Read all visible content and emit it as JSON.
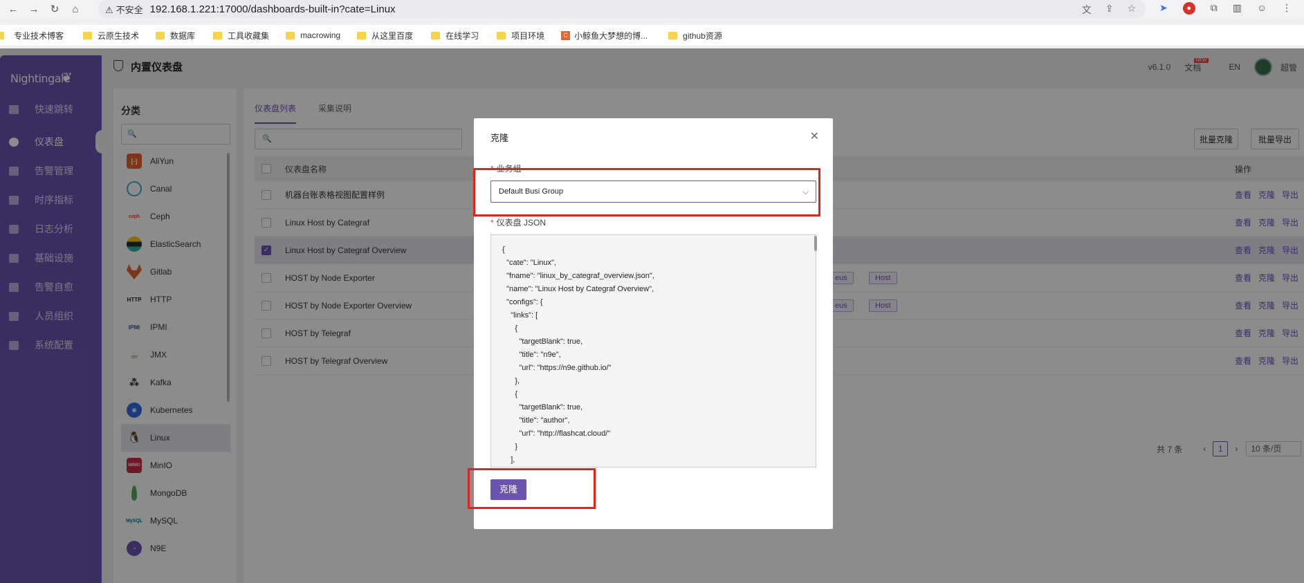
{
  "browser": {
    "insecure_label": "不安全",
    "url": "192.168.1.221:17000/dashboards-built-in?cate=Linux"
  },
  "bookmarks": [
    {
      "label": "专业技术博客"
    },
    {
      "label": "云原生技术"
    },
    {
      "label": "数据库"
    },
    {
      "label": "工具收藏集"
    },
    {
      "label": "macrowing"
    },
    {
      "label": "从这里百度"
    },
    {
      "label": "在线学习"
    },
    {
      "label": "项目环境"
    },
    {
      "label": "小鲸鱼大梦想的博..."
    },
    {
      "label": "github资源"
    }
  ],
  "app": {
    "logo": "Nightingale",
    "menu": [
      {
        "label": "快速跳转"
      },
      {
        "label": "仪表盘"
      },
      {
        "label": "告警管理"
      },
      {
        "label": "时序指标"
      },
      {
        "label": "日志分析"
      },
      {
        "label": "基础设施"
      },
      {
        "label": "告警自愈"
      },
      {
        "label": "人员组织"
      },
      {
        "label": "系统配置"
      }
    ],
    "page_title": "内置仪表盘",
    "version": "v6.1.0",
    "docs": "文档",
    "docs_badge": "NEW",
    "lang": "EN",
    "user": "超管"
  },
  "category": {
    "title": "分类",
    "items": [
      {
        "label": "AliYun",
        "icon": "aliyun-icon",
        "color": "#e8622b"
      },
      {
        "label": "Canal",
        "icon": "canal-icon",
        "color": "#3aa9d9"
      },
      {
        "label": "Ceph",
        "icon": "ceph-icon",
        "color": "#e53e3e"
      },
      {
        "label": "ElasticSearch",
        "icon": "elasticsearch-icon",
        "color": "#2b2b2b"
      },
      {
        "label": "Gitlab",
        "icon": "gitlab-icon",
        "color": "#e8622b"
      },
      {
        "label": "HTTP",
        "icon": "http-icon",
        "color": "#222222"
      },
      {
        "label": "IPMI",
        "icon": "ipmi-icon",
        "color": "#3a4f8a"
      },
      {
        "label": "JMX",
        "icon": "jmx-icon",
        "color": "#d9822b"
      },
      {
        "label": "Kafka",
        "icon": "kafka-icon",
        "color": "#222222"
      },
      {
        "label": "Kubernetes",
        "icon": "kubernetes-icon",
        "color": "#326ce5"
      },
      {
        "label": "Linux",
        "icon": "linux-icon",
        "color": "#222222"
      },
      {
        "label": "MinIO",
        "icon": "minio-icon",
        "color": "#c72c48"
      },
      {
        "label": "MongoDB",
        "icon": "mongodb-icon",
        "color": "#4caf50"
      },
      {
        "label": "MySQL",
        "icon": "mysql-icon",
        "color": "#00758f"
      },
      {
        "label": "N9E",
        "icon": "n9e-icon",
        "color": "#6c53b1"
      }
    ]
  },
  "list": {
    "tabs": [
      {
        "label": "仪表盘列表"
      },
      {
        "label": "采集说明"
      }
    ],
    "batch_clone": "批量克隆",
    "batch_export": "批量导出",
    "col_name": "仪表盘名称",
    "col_ops": "操作",
    "rows": [
      {
        "name": "机器台账表格视图配置样例",
        "tags": []
      },
      {
        "name": "Linux Host by Categraf",
        "tags": []
      },
      {
        "name": "Linux Host by Categraf Overview",
        "tags": [],
        "selected": true
      },
      {
        "name": "HOST by Node Exporter",
        "tags": [
          "eus",
          "Host"
        ]
      },
      {
        "name": "HOST by Node Exporter Overview",
        "tags": [
          "eus",
          "Host"
        ]
      },
      {
        "name": "HOST by Telegraf",
        "tags": []
      },
      {
        "name": "HOST by Telegraf Overview",
        "tags": []
      }
    ],
    "op_view": "查看",
    "op_clone": "克隆",
    "op_export": "导出",
    "total": "共 7 条",
    "page": "1",
    "page_size": "10 条/页"
  },
  "modal": {
    "title": "克隆",
    "busi_label": "业务组",
    "busi_value": "Default Busi Group",
    "json_label": "仪表盘 JSON",
    "json_text": "{\n  \"cate\": \"Linux\",\n  \"fname\": \"linux_by_categraf_overview.json\",\n  \"name\": \"Linux Host by Categraf Overview\",\n  \"configs\": {\n    \"links\": [\n      {\n        \"targetBlank\": true,\n        \"title\": \"n9e\",\n        \"url\": \"https://n9e.github.io/\"\n      },\n      {\n        \"targetBlank\": true,\n        \"title\": \"author\",\n        \"url\": \"http://flashcat.cloud/\"\n      }\n    ],",
    "submit": "克隆"
  }
}
